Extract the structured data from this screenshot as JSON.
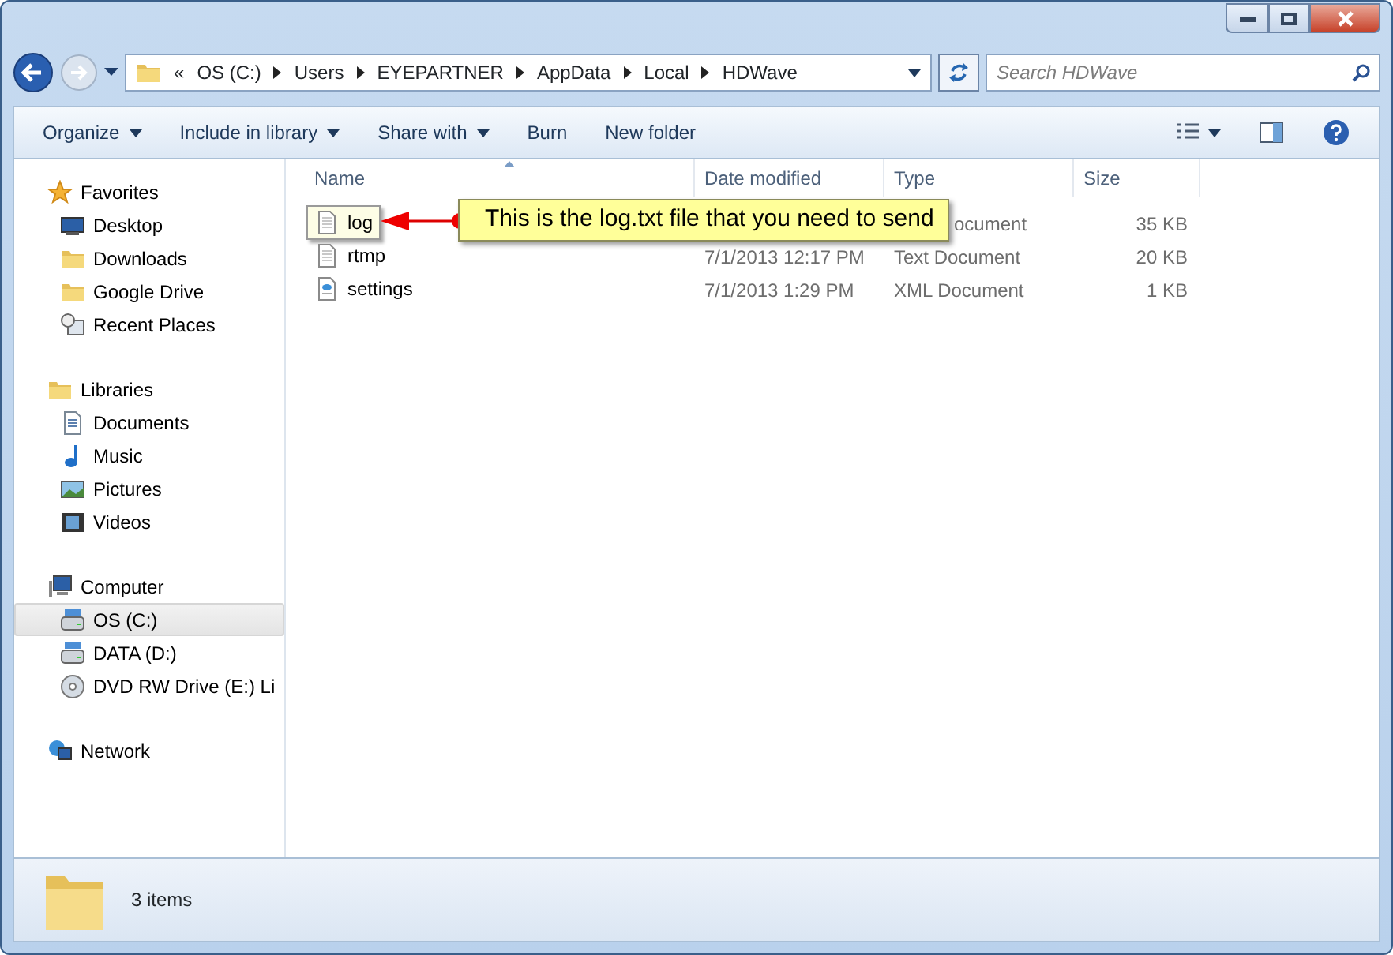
{
  "address": {
    "crumbs": [
      "OS (C:)",
      "Users",
      "EYEPARTNER",
      "AppData",
      "Local",
      "HDWave"
    ],
    "overflow": "«"
  },
  "search": {
    "placeholder": "Search HDWave"
  },
  "toolbar": [
    {
      "label": "Organize",
      "caret": true
    },
    {
      "label": "Include in library",
      "caret": true
    },
    {
      "label": "Share with",
      "caret": true
    },
    {
      "label": "Burn",
      "caret": false
    },
    {
      "label": "New folder",
      "caret": false
    }
  ],
  "sidebar": [
    {
      "label": "Favorites",
      "kind": "star",
      "items": [
        {
          "label": "Desktop",
          "kind": "desktop",
          "selected": false
        },
        {
          "label": "Downloads",
          "kind": "folder",
          "selected": false
        },
        {
          "label": "Google Drive",
          "kind": "folder",
          "selected": false
        },
        {
          "label": "Recent Places",
          "kind": "recent",
          "selected": false
        }
      ]
    },
    {
      "label": "Libraries",
      "kind": "folder",
      "items": [
        {
          "label": "Documents",
          "kind": "doc",
          "selected": false
        },
        {
          "label": "Music",
          "kind": "music",
          "selected": false
        },
        {
          "label": "Pictures",
          "kind": "pictures",
          "selected": false
        },
        {
          "label": "Videos",
          "kind": "video",
          "selected": false
        }
      ]
    },
    {
      "label": "Computer",
      "kind": "computer",
      "items": [
        {
          "label": "OS (C:)",
          "kind": "drive",
          "selected": true
        },
        {
          "label": "DATA (D:)",
          "kind": "drive",
          "selected": false
        },
        {
          "label": "DVD RW Drive (E:) Li",
          "kind": "disc",
          "selected": false
        }
      ]
    },
    {
      "label": "Network",
      "kind": "network"
    }
  ],
  "columns": [
    "Name",
    "Date modified",
    "Type",
    "Size"
  ],
  "files": [
    {
      "name": "log",
      "type": "ocument",
      "size": "35 KB",
      "kind": "text",
      "highlighted": true
    },
    {
      "name": "rtmp",
      "date": "7/1/2013 12:17 PM",
      "type": "Text Document",
      "size": "20 KB",
      "kind": "text",
      "highlighted": false
    },
    {
      "name": "settings",
      "date": "7/1/2013 1:29 PM",
      "type": "XML Document",
      "size": "1 KB",
      "kind": "xml",
      "highlighted": false
    }
  ],
  "callout": {
    "text": "This is the log.txt file that you need to send"
  },
  "status": {
    "count": "3 items"
  }
}
